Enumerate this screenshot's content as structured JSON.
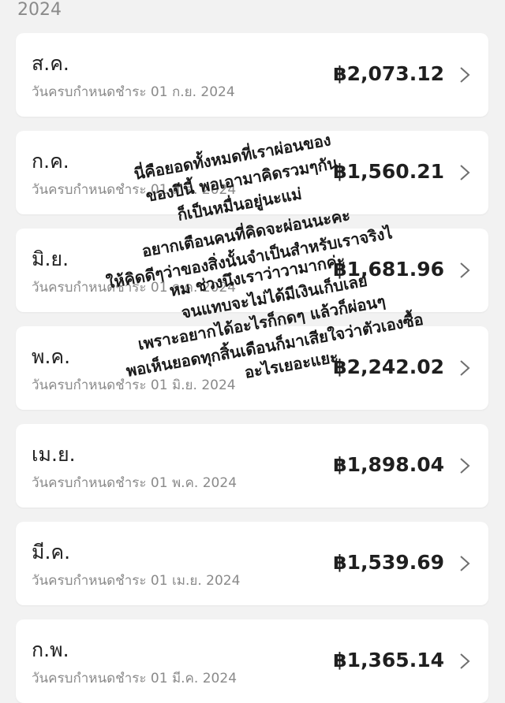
{
  "header": {
    "year": "2024"
  },
  "bills": [
    {
      "month": "ส.ค.",
      "due": "วันครบกำหนดชำระ 01 ก.ย. 2024",
      "amount": "฿2,073.12"
    },
    {
      "month": "ก.ค.",
      "due": "วันครบกำหนดชำระ 01 ส.ค. 2024",
      "amount": "฿1,560.21"
    },
    {
      "month": "มิ.ย.",
      "due": "วันครบกำหนดชำระ 01 ก.ค. 2024",
      "amount": "฿1,681.96"
    },
    {
      "month": "พ.ค.",
      "due": "วันครบกำหนดชำระ 01 มิ.ย. 2024",
      "amount": "฿2,242.02"
    },
    {
      "month": "เม.ย.",
      "due": "วันครบกำหนดชำระ 01 พ.ค. 2024",
      "amount": "฿1,898.04"
    },
    {
      "month": "มี.ค.",
      "due": "วันครบกำหนดชำระ 01 เม.ย. 2024",
      "amount": "฿1,539.69"
    },
    {
      "month": "ก.พ.",
      "due": "วันครบกำหนดชำระ 01 มี.ค. 2024",
      "amount": "฿1,365.14"
    }
  ],
  "icons": {
    "row_chevron": "chevron-right-icon"
  },
  "overlay_text": [
    "นี่คือยอดทั้งหมดที่เราผ่อนของ",
    "ของปีนี้ พอเอามาคิดรวมๆกัน",
    "ก็เป็นหมื่นอยู่นะแม่",
    "อยากเตือนคนที่คิดจะผ่อนนะคะ",
    "ให้คิดดีๆว่าของสิ่งนั้นจำเป็นสำหรับเราจริงไ",
    "หม ช่วงนึงเราว่าวามากค่ะ",
    "จนแทบจะไม่ได้มีเงินเก็บเลย",
    "เพราะอยากได้อะไรก็กดๆ แล้วก็ผ่อนๆ",
    "พอเห็นยอดทุกสิ้นเดือนก็มาเสียใจว่าตัวเองซื้อ",
    "อะไรเยอะแยะ"
  ]
}
